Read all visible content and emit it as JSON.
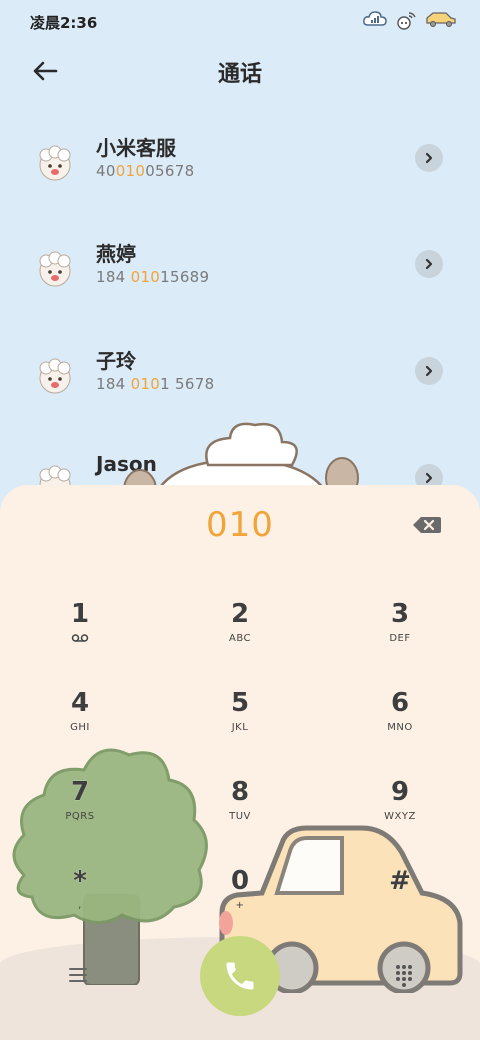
{
  "status": {
    "time": "凌晨2:36"
  },
  "header": {
    "title": "通话"
  },
  "contacts": [
    {
      "name": "小米客服",
      "number_pre": "40",
      "number_hl": "010",
      "number_post": "05678"
    },
    {
      "name": "燕婷",
      "number_pre": "184 ",
      "number_hl": "010",
      "number_post": "15689"
    },
    {
      "name": "子玲",
      "number_pre": "184 ",
      "number_hl": "010",
      "number_post": "1 5678"
    },
    {
      "name": "Jason",
      "number_pre": "",
      "number_hl": "",
      "number_post": ""
    }
  ],
  "dialer": {
    "entered": "010",
    "keys": [
      {
        "digit": "1",
        "letters": ""
      },
      {
        "digit": "2",
        "letters": "ABC"
      },
      {
        "digit": "3",
        "letters": "DEF"
      },
      {
        "digit": "4",
        "letters": "GHI"
      },
      {
        "digit": "5",
        "letters": "JKL"
      },
      {
        "digit": "6",
        "letters": "MNO"
      },
      {
        "digit": "7",
        "letters": "PQRS"
      },
      {
        "digit": "8",
        "letters": "TUV"
      },
      {
        "digit": "9",
        "letters": "WXYZ"
      },
      {
        "digit": "*",
        "letters": ","
      },
      {
        "digit": "0",
        "letters": "+"
      },
      {
        "digit": "#",
        "letters": ""
      }
    ]
  },
  "icons": {
    "back": "back-arrow-icon",
    "arrow": "chevron-right-icon",
    "backspace": "backspace-icon",
    "call": "phone-icon",
    "menu": "menu-icon",
    "keypad": "dialpad-icon",
    "voicemail": "voicemail-icon"
  },
  "colors": {
    "accent": "#f0a43a",
    "call_button": "#c8d87f",
    "background_top": "#dcebf8",
    "dialpad_bg": "#fcf1e4"
  }
}
